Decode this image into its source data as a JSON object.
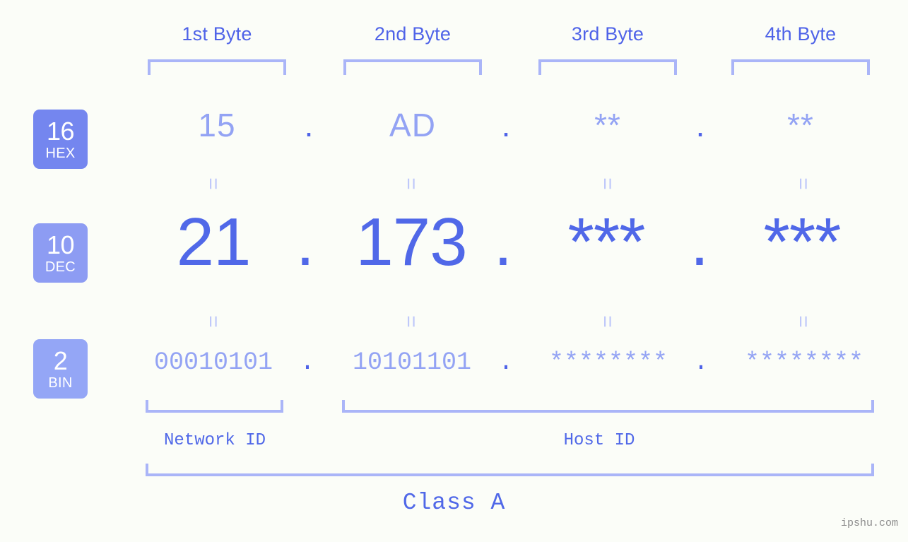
{
  "page": {
    "background": "#fbfdf8",
    "accent_strong": "#5068e8",
    "accent_light": "#93a3f4",
    "bracket_color": "#aab5f8",
    "watermark": "ipshu.com"
  },
  "byte_headers": [
    {
      "label": "1st Byte"
    },
    {
      "label": "2nd Byte"
    },
    {
      "label": "3rd Byte"
    },
    {
      "label": "4th Byte"
    }
  ],
  "bases": [
    {
      "number": "16",
      "system": "HEX",
      "color": "#7486ef"
    },
    {
      "number": "10",
      "system": "DEC",
      "color": "#8d9cf3"
    },
    {
      "number": "2",
      "system": "BIN",
      "color": "#94a6f6"
    }
  ],
  "rows": {
    "hex": {
      "values": [
        "15",
        "AD",
        "**",
        "**"
      ],
      "separator": "."
    },
    "dec": {
      "values": [
        "21",
        "173",
        "***",
        "***"
      ],
      "separator": "."
    },
    "bin": {
      "values": [
        "00010101",
        "10101101",
        "********",
        "********"
      ],
      "separator": "."
    }
  },
  "equals_glyph": "=",
  "id_labels": {
    "network": "Network ID",
    "host": "Host ID"
  },
  "class": {
    "label": "Class A"
  }
}
